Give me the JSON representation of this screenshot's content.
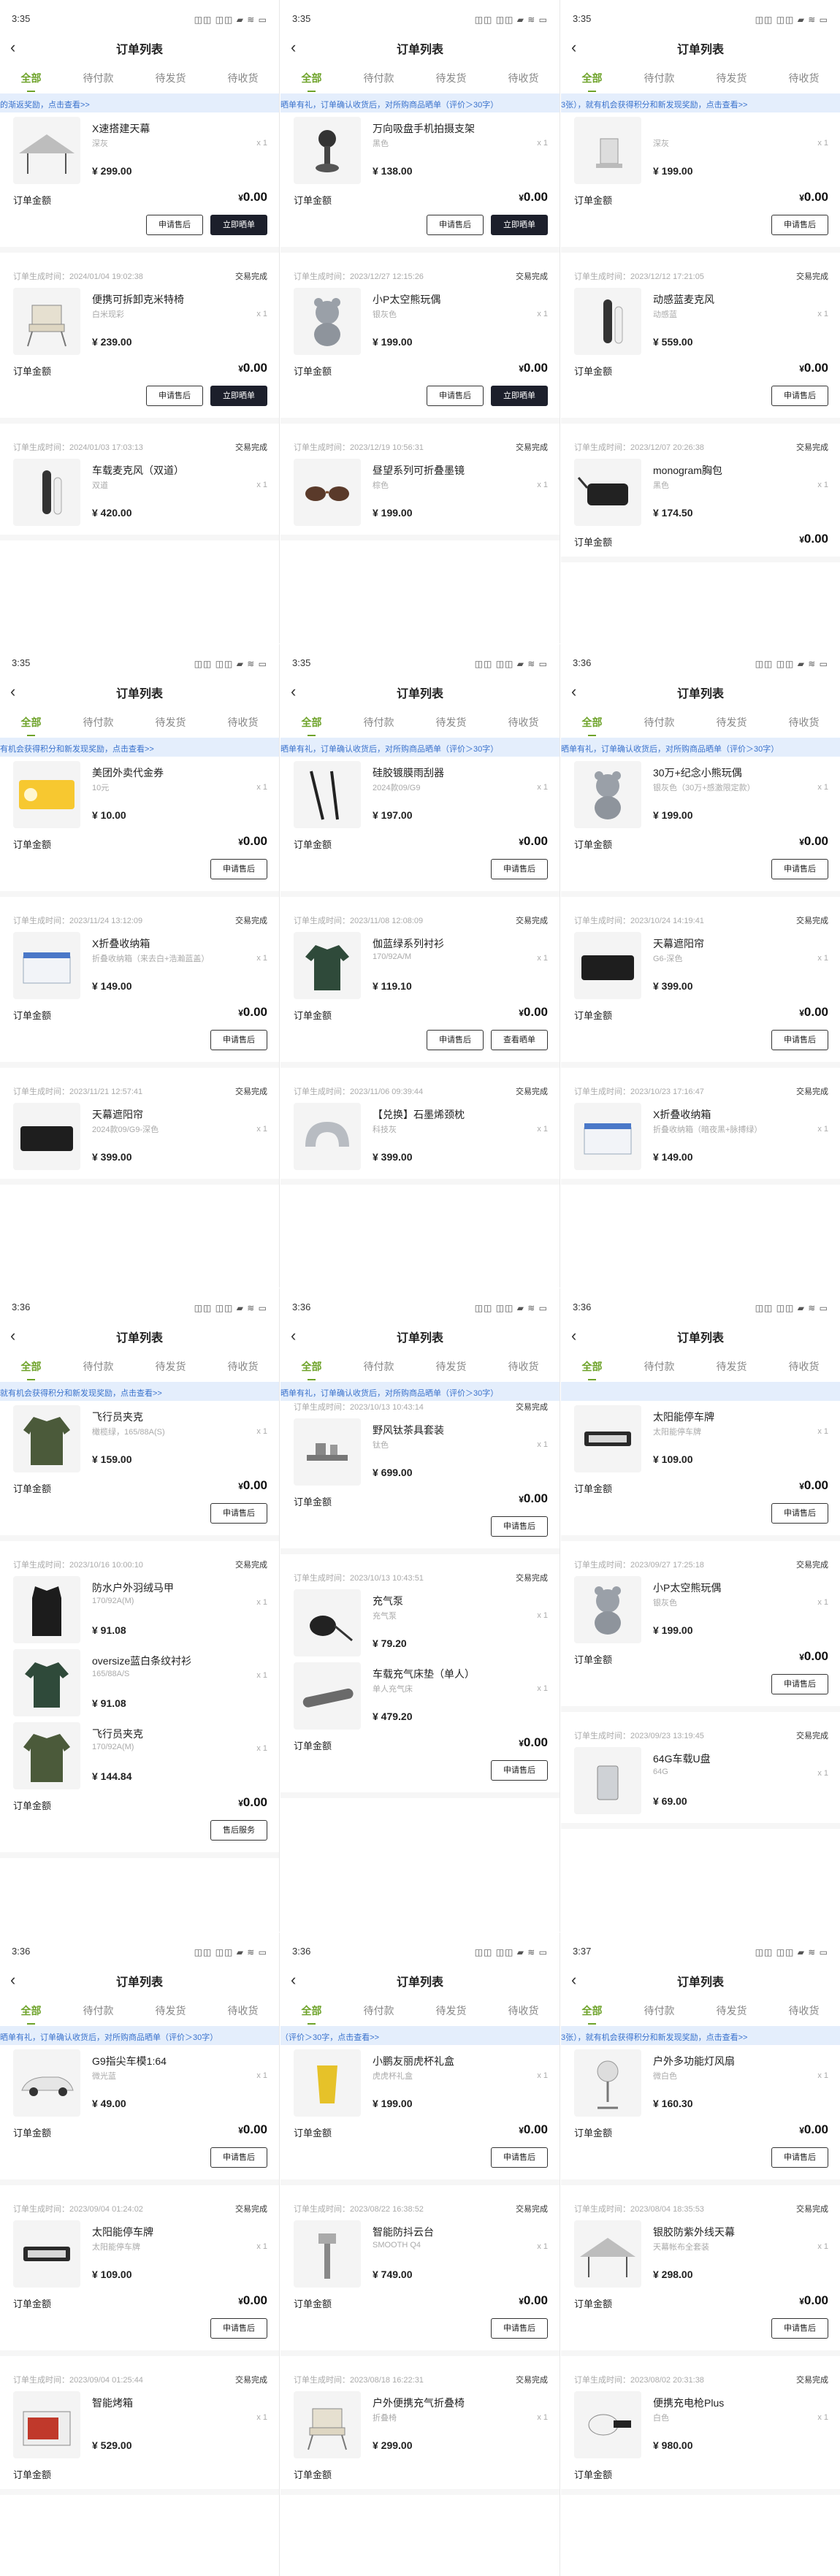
{
  "panels": [
    {
      "time": "3:35",
      "status_icons": "◫◫ ◫◫ ▰ ≋ ▭",
      "title": "订单列表",
      "tabs": [
        "全部",
        "待付款",
        "待发货",
        "待收货"
      ],
      "active_tab": 0,
      "banner": "的渐返奖励，点击查看>>",
      "cards": [
        {
          "head": "",
          "status": "",
          "items": [
            {
              "name": "X速搭建天幕",
              "spec": "深灰",
              "qty": "x 1",
              "price": "¥ 299.00",
              "icon": "tent-canopy-icon"
            }
          ],
          "total_label": "订单金额",
          "total": "0.00",
          "buttons": [
            "申请售后",
            "立即晒单"
          ],
          "dark": [
            1
          ]
        },
        {
          "head": "订单生成时间：2024/01/04 19:02:38",
          "status": "交易完成",
          "items": [
            {
              "name": "便携可拆卸克米特椅",
              "spec": "白米现彩",
              "qty": "x 1",
              "price": "¥ 239.00",
              "icon": "folding-chair-icon"
            }
          ],
          "total_label": "订单金额",
          "total": "0.00",
          "buttons": [
            "申请售后",
            "立即晒单"
          ],
          "dark": [
            1
          ]
        },
        {
          "head": "订单生成时间：2024/01/03 17:03:13",
          "status": "交易完成",
          "items": [
            {
              "name": "车载麦克风（双道）",
              "spec": "双道",
              "qty": "x 1",
              "price": "¥ 420.00",
              "icon": "microphone-icon"
            }
          ],
          "total_label": "",
          "total": "",
          "buttons": [],
          "dark": []
        }
      ]
    },
    {
      "time": "3:35",
      "status_icons": "◫◫ ◫◫ ▰ ≋ ▭",
      "title": "订单列表",
      "tabs": [
        "全部",
        "待付款",
        "待发货",
        "待收货"
      ],
      "active_tab": 0,
      "banner": "晒单有礼，订单确认收货后，对所购商品晒单（评价＞30字）",
      "cards": [
        {
          "head": "",
          "status": "",
          "items": [
            {
              "name": "万向吸盘手机拍摄支架",
              "spec": "黑色",
              "qty": "x 1",
              "price": "¥ 138.00",
              "icon": "phone-mount-icon"
            }
          ],
          "total_label": "订单金额",
          "total": "0.00",
          "buttons": [
            "申请售后",
            "立即晒单"
          ],
          "dark": [
            1
          ]
        },
        {
          "head": "订单生成时间：2023/12/27 12:15:26",
          "status": "交易完成",
          "items": [
            {
              "name": "小P太空熊玩偶",
              "spec": "银灰色",
              "qty": "x 1",
              "price": "¥ 199.00",
              "icon": "bear-plush-icon"
            }
          ],
          "total_label": "订单金额",
          "total": "0.00",
          "buttons": [
            "申请售后",
            "立即晒单"
          ],
          "dark": [
            1
          ]
        },
        {
          "head": "订单生成时间：2023/12/19 10:56:31",
          "status": "交易完成",
          "items": [
            {
              "name": "昼望系列可折叠墨镜",
              "spec": "棕色",
              "qty": "x 1",
              "price": "¥ 199.00",
              "icon": "sunglasses-icon"
            }
          ],
          "total_label": "",
          "total": "",
          "buttons": [],
          "dark": []
        }
      ]
    },
    {
      "time": "3:35",
      "status_icons": "◫◫ ◫◫ ▰ ≋ ▭",
      "title": "订单列表",
      "tabs": [
        "全部",
        "待付款",
        "待发货",
        "待收货"
      ],
      "active_tab": 0,
      "banner": "3张），就有机会获得积分和新发现奖励，点击查看>>",
      "cards": [
        {
          "head": "",
          "status": "",
          "items": [
            {
              "name": "",
              "spec": "深灰",
              "qty": "x 1",
              "price": "¥ 199.00",
              "icon": "lamp-icon"
            }
          ],
          "total_label": "订单金额",
          "total": "0.00",
          "buttons": [
            "申请售后"
          ],
          "dark": []
        },
        {
          "head": "订单生成时间：2023/12/12 17:21:05",
          "status": "交易完成",
          "items": [
            {
              "name": "动感蓝麦克风",
              "spec": "动感蓝",
              "qty": "x 1",
              "price": "¥ 559.00",
              "icon": "microphone-icon"
            }
          ],
          "total_label": "订单金额",
          "total": "0.00",
          "buttons": [
            "申请售后"
          ],
          "dark": []
        },
        {
          "head": "订单生成时间：2023/12/07 20:26:38",
          "status": "交易完成",
          "items": [
            {
              "name": "monogram胸包",
              "spec": "黑色",
              "qty": "x 1",
              "price": "¥ 174.50",
              "icon": "chest-bag-icon"
            }
          ],
          "total_label": "订单金额",
          "total": "0.00",
          "buttons": [],
          "dark": []
        }
      ]
    },
    {
      "time": "3:35",
      "status_icons": "◫◫ ◫◫ ▰ ≋ ▭",
      "title": "订单列表",
      "tabs": [
        "全部",
        "待付款",
        "待发货",
        "待收货"
      ],
      "active_tab": 0,
      "banner": "有机会获得积分和新发现奖励，点击查看>>",
      "cards": [
        {
          "head": "",
          "status": "",
          "items": [
            {
              "name": "美团外卖代金券",
              "spec": "10元",
              "qty": "x 1",
              "price": "¥ 10.00",
              "icon": "coupon-icon"
            }
          ],
          "total_label": "订单金额",
          "total": "0.00",
          "buttons": [
            "申请售后"
          ],
          "dark": []
        },
        {
          "head": "订单生成时间：2023/11/24 13:12:09",
          "status": "交易完成",
          "items": [
            {
              "name": "X折叠收纳箱",
              "spec": "折叠收纳箱（来去白+浩瀚蓝盖）",
              "qty": "x 1",
              "price": "¥ 149.00",
              "icon": "storage-box-icon"
            }
          ],
          "total_label": "订单金额",
          "total": "0.00",
          "buttons": [
            "申请售后"
          ],
          "dark": []
        },
        {
          "head": "订单生成时间：2023/11/21 12:57:41",
          "status": "交易完成",
          "items": [
            {
              "name": "天幕遮阳帘",
              "spec": "2024款09/G9-深色",
              "qty": "x 1",
              "price": "¥ 399.00",
              "icon": "sunshade-icon"
            }
          ],
          "total_label": "",
          "total": "",
          "buttons": [],
          "dark": []
        }
      ]
    },
    {
      "time": "3:35",
      "status_icons": "◫◫ ◫◫ ▰ ≋ ▭",
      "title": "订单列表",
      "tabs": [
        "全部",
        "待付款",
        "待发货",
        "待收货"
      ],
      "active_tab": 0,
      "banner": "晒单有礼，订单确认收货后，对所购商品晒单（评价＞30字）",
      "cards": [
        {
          "head": "",
          "status": "",
          "items": [
            {
              "name": "硅胶镀膜雨刮器",
              "spec": "2024款09/G9",
              "qty": "x 1",
              "price": "¥ 197.00",
              "icon": "wiper-icon"
            }
          ],
          "total_label": "订单金额",
          "total": "0.00",
          "buttons": [
            "申请售后"
          ],
          "dark": []
        },
        {
          "head": "订单生成时间：2023/11/08 12:08:09",
          "status": "交易完成",
          "items": [
            {
              "name": "伽蓝绿系列衬衫",
              "spec": "170/92A/M",
              "qty": "x 1",
              "price": "¥ 119.10",
              "icon": "shirt-icon"
            }
          ],
          "total_label": "订单金额",
          "total": "0.00",
          "buttons": [
            "申请售后",
            "查看晒单"
          ],
          "dark": []
        },
        {
          "head": "订单生成时间：2023/11/06 09:39:44",
          "status": "交易完成",
          "items": [
            {
              "name": "【兑换】石墨烯颈枕",
              "spec": "科技灰",
              "qty": "x 1",
              "price": "¥ 399.00",
              "icon": "neck-pillow-icon"
            }
          ],
          "total_label": "",
          "total": "",
          "buttons": [],
          "dark": []
        }
      ]
    },
    {
      "time": "3:36",
      "status_icons": "◫◫ ◫◫ ▰ ≋ ▭",
      "title": "订单列表",
      "tabs": [
        "全部",
        "待付款",
        "待发货",
        "待收货"
      ],
      "active_tab": 0,
      "banner": "晒单有礼，订单确认收货后，对所购商品晒单（评价＞30字）",
      "cards": [
        {
          "head": "",
          "status": "",
          "items": [
            {
              "name": "30万+纪念小熊玩偶",
              "spec": "银灰色（30万+感激限定款）",
              "qty": "x 1",
              "price": "¥ 199.00",
              "icon": "bear-plush-icon"
            }
          ],
          "total_label": "订单金额",
          "total": "0.00",
          "buttons": [
            "申请售后"
          ],
          "dark": []
        },
        {
          "head": "订单生成时间：2023/10/24 14:19:41",
          "status": "交易完成",
          "items": [
            {
              "name": "天幕遮阳帘",
              "spec": "G6-深色",
              "qty": "x 1",
              "price": "¥ 399.00",
              "icon": "sunshade-icon"
            }
          ],
          "total_label": "订单金额",
          "total": "0.00",
          "buttons": [
            "申请售后"
          ],
          "dark": []
        },
        {
          "head": "订单生成时间：2023/10/23 17:16:47",
          "status": "交易完成",
          "items": [
            {
              "name": "X折叠收纳箱",
              "spec": "折叠收纳箱（暗夜黑+脉搏绿）",
              "qty": "x 1",
              "price": "¥ 149.00",
              "icon": "storage-box-icon"
            }
          ],
          "total_label": "",
          "total": "",
          "buttons": [],
          "dark": []
        }
      ]
    },
    {
      "time": "3:36",
      "status_icons": "◫◫ ◫◫ ▰ ≋ ▭",
      "title": "订单列表",
      "tabs": [
        "全部",
        "待付款",
        "待发货",
        "待收货"
      ],
      "active_tab": 0,
      "banner": "就有机会获得积分和新发现奖励，点击查看>>",
      "cards": [
        {
          "head": "",
          "status": "",
          "items": [
            {
              "name": "飞行员夹克",
              "spec": "橄榄绿，165/88A(S)",
              "qty": "x 1",
              "price": "¥ 159.00",
              "icon": "jacket-icon"
            }
          ],
          "total_label": "订单金额",
          "total": "0.00",
          "buttons": [
            "申请售后"
          ],
          "dark": []
        },
        {
          "head": "订单生成时间：2023/10/16 10:00:10",
          "status": "交易完成",
          "items": [
            {
              "name": "防水户外羽绒马甲",
              "spec": "170/92A(M)",
              "qty": "x 1",
              "price": "¥ 91.08",
              "icon": "vest-icon"
            },
            {
              "name": "oversize蓝白条纹衬衫",
              "spec": "165/88A/S",
              "qty": "x 1",
              "price": "¥ 91.08",
              "icon": "shirt-icon"
            },
            {
              "name": "飞行员夹克",
              "spec": "170/92A(M)",
              "qty": "x 1",
              "price": "¥ 144.84",
              "icon": "jacket-icon"
            }
          ],
          "total_label": "订单金额",
          "total": "0.00",
          "buttons": [
            "售后服务"
          ],
          "dark": []
        }
      ]
    },
    {
      "time": "3:36",
      "status_icons": "◫◫ ◫◫ ▰ ≋ ▭",
      "title": "订单列表",
      "tabs": [
        "全部",
        "待付款",
        "待发货",
        "待收货"
      ],
      "active_tab": 0,
      "banner": "晒单有礼，订单确认收货后，对所购商品晒单（评价＞30字）",
      "cards": [
        {
          "head": "订单生成时间：2023/10/13 10:43:14",
          "status": "交易完成",
          "items": [
            {
              "name": "野风钛茶具套装",
              "spec": "钛色",
              "qty": "x 1",
              "price": "¥ 699.00",
              "icon": "tea-set-icon"
            }
          ],
          "total_label": "订单金额",
          "total": "0.00",
          "buttons": [
            "申请售后"
          ],
          "dark": []
        },
        {
          "head": "订单生成时间：2023/10/13 10:43:51",
          "status": "交易完成",
          "items": [
            {
              "name": "充气泵",
              "spec": "充气泵",
              "qty": "x 1",
              "price": "¥ 79.20",
              "icon": "air-pump-icon"
            },
            {
              "name": "车载充气床垫（单人）",
              "spec": "单人充气床",
              "qty": "x 1",
              "price": "¥ 479.20",
              "icon": "air-mattress-icon"
            }
          ],
          "total_label": "订单金额",
          "total": "0.00",
          "buttons": [
            "申请售后"
          ],
          "dark": []
        }
      ]
    },
    {
      "time": "3:36",
      "status_icons": "◫◫ ◫◫ ▰ ≋ ▭",
      "title": "订单列表",
      "tabs": [
        "全部",
        "待付款",
        "待发货",
        "待收货"
      ],
      "active_tab": 0,
      "banner": "",
      "cards": [
        {
          "head": "",
          "status": "",
          "items": [
            {
              "name": "太阳能停车牌",
              "spec": "太阳能停车牌",
              "qty": "x 1",
              "price": "¥ 109.00",
              "icon": "parking-sign-icon"
            }
          ],
          "total_label": "订单金额",
          "total": "0.00",
          "buttons": [
            "申请售后"
          ],
          "dark": []
        },
        {
          "head": "订单生成时间：2023/09/27 17:25:18",
          "status": "交易完成",
          "items": [
            {
              "name": "小P太空熊玩偶",
              "spec": "银灰色",
              "qty": "x 1",
              "price": "¥ 199.00",
              "icon": "bear-plush-icon"
            }
          ],
          "total_label": "订单金额",
          "total": "0.00",
          "buttons": [
            "申请售后"
          ],
          "dark": []
        },
        {
          "head": "订单生成时间：2023/09/23 13:19:45",
          "status": "交易完成",
          "items": [
            {
              "name": "64G车载U盘",
              "spec": "64G",
              "qty": "x 1",
              "price": "¥ 69.00",
              "icon": "usb-drive-icon"
            }
          ],
          "total_label": "",
          "total": "",
          "buttons": [],
          "dark": []
        }
      ]
    },
    {
      "time": "3:36",
      "status_icons": "◫◫ ◫◫ ▰ ≋ ▭",
      "title": "订单列表",
      "tabs": [
        "全部",
        "待付款",
        "待发货",
        "待收货"
      ],
      "active_tab": 0,
      "banner": "晒单有礼，订单确认收货后，对所购商品晒单（评价＞30字）",
      "cards": [
        {
          "head": "",
          "status": "",
          "items": [
            {
              "name": "G9指尖车模1:64",
              "spec": "微光蓝",
              "qty": "x 1",
              "price": "¥ 49.00",
              "icon": "car-model-icon"
            }
          ],
          "total_label": "订单金额",
          "total": "0.00",
          "buttons": [
            "申请售后"
          ],
          "dark": []
        },
        {
          "head": "订单生成时间：2023/09/04 01:24:02",
          "status": "交易完成",
          "items": [
            {
              "name": "太阳能停车牌",
              "spec": "太阳能停车牌",
              "qty": "x 1",
              "price": "¥ 109.00",
              "icon": "parking-sign-icon"
            }
          ],
          "total_label": "订单金额",
          "total": "0.00",
          "buttons": [
            "申请售后"
          ],
          "dark": []
        },
        {
          "head": "订单生成时间：2023/09/04 01:25:44",
          "status": "交易完成",
          "items": [
            {
              "name": "智能烤箱",
              "spec": "",
              "qty": "x 1",
              "price": "¥ 529.00",
              "icon": "oven-icon"
            }
          ],
          "total_label": "订单金额",
          "total": "",
          "buttons": [],
          "dark": []
        }
      ]
    },
    {
      "time": "3:36",
      "status_icons": "◫◫ ◫◫ ▰ ≋ ▭",
      "title": "订单列表",
      "tabs": [
        "全部",
        "待付款",
        "待发货",
        "待收货"
      ],
      "active_tab": 0,
      "banner": "（评价＞30字，点击查看>>",
      "cards": [
        {
          "head": "",
          "status": "",
          "items": [
            {
              "name": "小鹏友丽虎杯礼盒",
              "spec": "虎虎杯礼盒",
              "qty": "x 1",
              "price": "¥ 199.00",
              "icon": "gift-cup-icon"
            }
          ],
          "total_label": "订单金额",
          "total": "0.00",
          "buttons": [
            "申请售后"
          ],
          "dark": []
        },
        {
          "head": "订单生成时间：2023/08/22 16:38:52",
          "status": "交易完成",
          "items": [
            {
              "name": "智能防抖云台",
              "spec": "SMOOTH Q4",
              "qty": "x 1",
              "price": "¥ 749.00",
              "icon": "gimbal-icon"
            }
          ],
          "total_label": "订单金额",
          "total": "0.00",
          "buttons": [
            "申请售后"
          ],
          "dark": []
        },
        {
          "head": "订单生成时间：2023/08/18 16:22:31",
          "status": "交易完成",
          "items": [
            {
              "name": "户外便携充气折叠椅",
              "spec": "折叠椅",
              "qty": "x 1",
              "price": "¥ 299.00",
              "icon": "folding-chair-icon"
            }
          ],
          "total_label": "订单金额",
          "total": "",
          "buttons": [],
          "dark": []
        }
      ]
    },
    {
      "time": "3:37",
      "status_icons": "◫◫ ◫◫ ▰ ≋ ▭",
      "title": "订单列表",
      "tabs": [
        "全部",
        "待付款",
        "待发货",
        "待收货"
      ],
      "active_tab": 0,
      "banner": "3张），就有机会获得积分和新发现奖励，点击查看>>",
      "cards": [
        {
          "head": "",
          "status": "",
          "items": [
            {
              "name": "户外多功能灯风扇",
              "spec": "微白色",
              "qty": "x 1",
              "price": "¥ 160.30",
              "icon": "lamp-fan-icon"
            }
          ],
          "total_label": "订单金额",
          "total": "0.00",
          "buttons": [
            "申请售后"
          ],
          "dark": []
        },
        {
          "head": "订单生成时间：2023/08/04 18:35:53",
          "status": "交易完成",
          "items": [
            {
              "name": "银胶防紫外线天幕",
              "spec": "天幕帐布全套装",
              "qty": "x 1",
              "price": "¥ 298.00",
              "icon": "tent-canopy-icon"
            }
          ],
          "total_label": "订单金额",
          "total": "0.00",
          "buttons": [
            "申请售后"
          ],
          "dark": []
        },
        {
          "head": "订单生成时间：2023/08/02 20:31:38",
          "status": "交易完成",
          "items": [
            {
              "name": "便携充电枪Plus",
              "spec": "白色",
              "qty": "x 1",
              "price": "¥ 980.00",
              "icon": "charging-gun-icon"
            }
          ],
          "total_label": "订单金额",
          "total": "",
          "buttons": [],
          "dark": []
        }
      ]
    }
  ],
  "colors": {
    "accent": "#6ea32a",
    "banner_bg": "#e4eefc",
    "banner_text": "#3a72cc",
    "dark_button": "#1c1f2b"
  },
  "currency_prefix": "¥"
}
